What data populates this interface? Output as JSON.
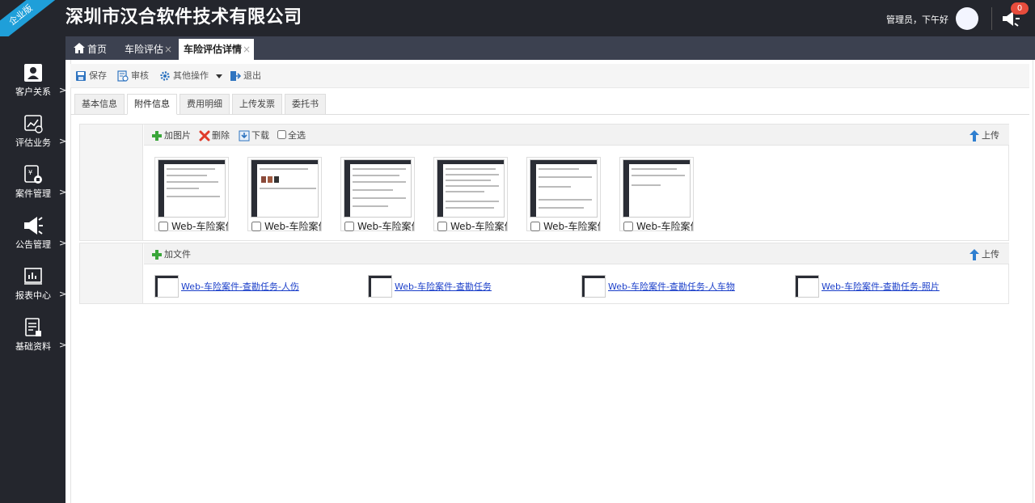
{
  "header": {
    "edition_badge": "企业版",
    "company": "深圳市汉合软件技术有限公司",
    "greeting": "管理员，下午好",
    "notice_count": "0"
  },
  "sidebar": {
    "items": [
      {
        "label": "客户关系",
        "icon": "contact-icon"
      },
      {
        "label": "评估业务",
        "icon": "chart-icon"
      },
      {
        "label": "案件管理",
        "icon": "case-icon"
      },
      {
        "label": "公告管理",
        "icon": "megaphone-icon"
      },
      {
        "label": "报表中心",
        "icon": "report-icon"
      },
      {
        "label": "基础资料",
        "icon": "document-icon"
      }
    ],
    "arrow": ">"
  },
  "page_tabs": [
    {
      "label": "首页"
    },
    {
      "label": "车险评估"
    },
    {
      "label": "车险评估详情"
    }
  ],
  "close_glyph": "×",
  "toolbar": {
    "save": "保存",
    "audit": "审核",
    "more": "其他操作",
    "exit": "退出"
  },
  "sub_tabs": [
    "基本信息",
    "附件信息",
    "费用明细",
    "上传发票",
    "委托书"
  ],
  "images_section": {
    "add_image": "加图片",
    "delete": "删除",
    "download": "下载",
    "select_all": "全选",
    "upload": "上传",
    "thumbnails": [
      "Web-车险案件",
      "Web-车险案件",
      "Web-车险案件",
      "Web-车险案件",
      "Web-车险案件",
      "Web-车险案件"
    ]
  },
  "files_section": {
    "add_file": "加文件",
    "upload": "上传",
    "files": [
      "Web-车险案件-查勘任务-人伤",
      "Web-车险案件-查勘任务",
      "Web-车险案件-查勘任务-人车物",
      "Web-车险案件-查勘任务-照片"
    ]
  },
  "colors": {
    "header_bg": "#24262d",
    "tabbar_bg": "#3c4150",
    "ribbon": "#1f9fd9",
    "link": "#1a3ec9",
    "badge": "#e74c3c"
  }
}
